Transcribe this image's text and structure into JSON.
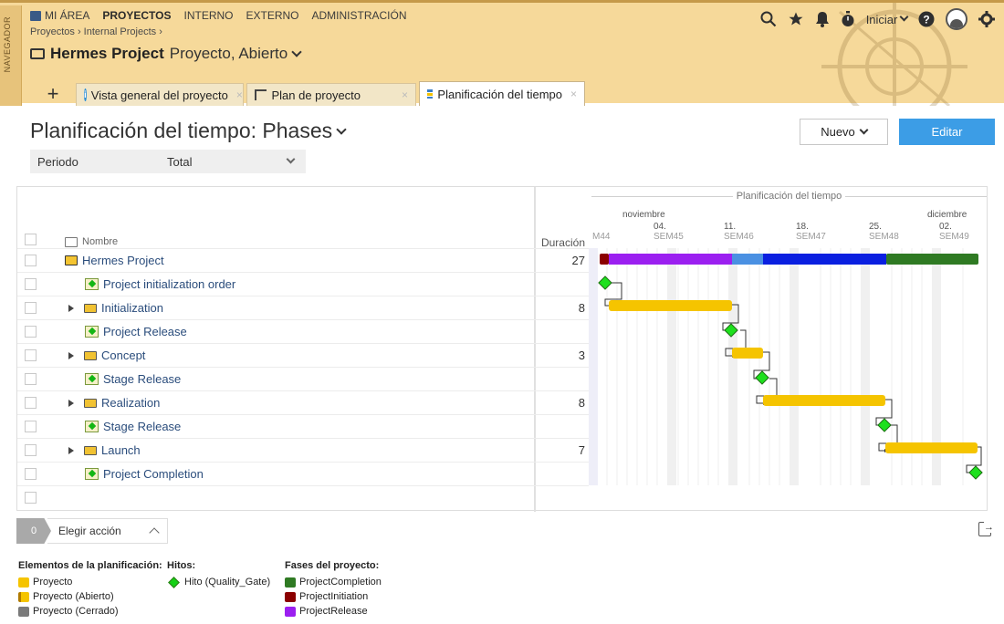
{
  "nav": {
    "navegador": "NAVEGADOR"
  },
  "topmenu": [
    "MI ÁREA",
    "PROYECTOS",
    "INTERNO",
    "EXTERNO",
    "ADMINISTRACIÓN"
  ],
  "topbar": {
    "iniciar": "Iniciar"
  },
  "breadcrumb": "Proyectos › Internal Projects ›",
  "project": {
    "name": "Hermes Project",
    "status": "Proyecto, Abierto"
  },
  "tabs": [
    {
      "label": "Vista general del proyecto"
    },
    {
      "label": "Plan de proyecto"
    },
    {
      "label": "Planificación del tiempo"
    }
  ],
  "page": {
    "title": "Planificación del tiempo: Phases",
    "period_label": "Periodo",
    "period_value": "Total"
  },
  "buttons": {
    "nuevo": "Nuevo",
    "editar": "Editar"
  },
  "grid": {
    "col_name": "Nombre",
    "col_duration": "Duración",
    "rows": [
      {
        "name": "Hermes Project",
        "duration": "27"
      },
      {
        "name": "Project initialization order",
        "duration": ""
      },
      {
        "name": "Initialization",
        "duration": "8"
      },
      {
        "name": "Project Release",
        "duration": ""
      },
      {
        "name": "Concept",
        "duration": "3"
      },
      {
        "name": "Stage Release",
        "duration": ""
      },
      {
        "name": "Realization",
        "duration": "8"
      },
      {
        "name": "Stage Release",
        "duration": ""
      },
      {
        "name": "Launch",
        "duration": "7"
      },
      {
        "name": "Project Completion",
        "duration": ""
      }
    ]
  },
  "gantt": {
    "title": "Planificación del tiempo",
    "months": [
      "noviembre",
      "diciembre"
    ],
    "ticks": [
      {
        "date": "",
        "week": "M44"
      },
      {
        "date": "04.",
        "week": "SEM45"
      },
      {
        "date": "11.",
        "week": "SEM46"
      },
      {
        "date": "18.",
        "week": "SEM47"
      },
      {
        "date": "25.",
        "week": "SEM48"
      },
      {
        "date": "02.",
        "week": "SEM49"
      }
    ],
    "colors": {
      "bar": "#f5c400",
      "milestone": "#1ee01e",
      "phase_initiation": "#8b0000",
      "phase_release": "#9b1ff0",
      "phase_light_blue": "#4a90e2",
      "phase_blue": "#0a1fe0",
      "phase_completion": "#2f7a23"
    }
  },
  "actions": {
    "count": "0",
    "elegir": "Elegir acción"
  },
  "legend": {
    "elements_title": "Elementos de la planificación:",
    "elements": [
      "Proyecto",
      "Proyecto (Abierto)",
      "Proyecto (Cerrado)"
    ],
    "hitos_title": "Hitos:",
    "hitos": [
      "Hito (Quality_Gate)"
    ],
    "fases_title": "Fases del proyecto:",
    "fases": [
      "ProjectCompletion",
      "ProjectInitiation",
      "ProjectRelease"
    ]
  }
}
